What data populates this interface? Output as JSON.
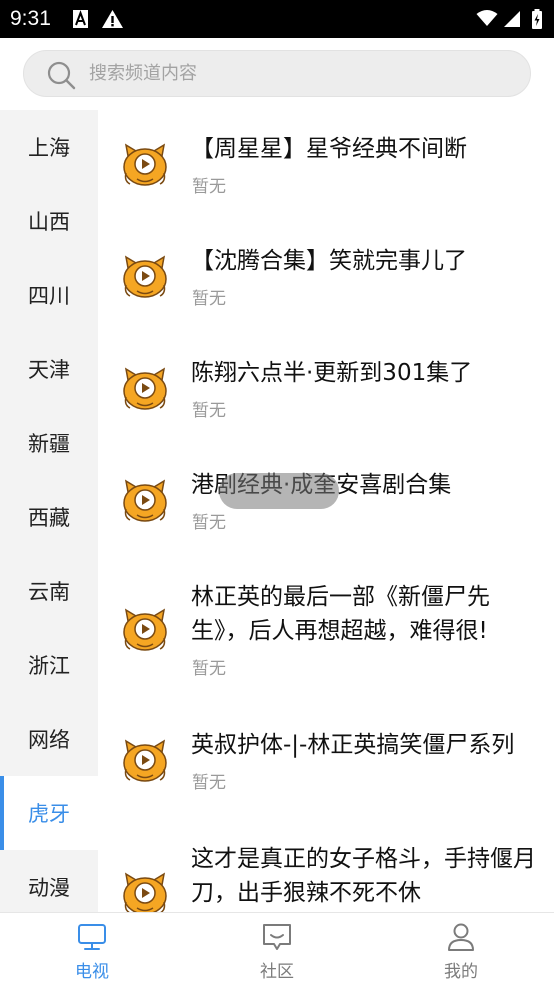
{
  "status_bar": {
    "time": "9:31"
  },
  "search": {
    "placeholder": "搜索频道内容"
  },
  "sidebar": {
    "active_index": 9,
    "items": [
      {
        "label": "上海"
      },
      {
        "label": "山西"
      },
      {
        "label": "四川"
      },
      {
        "label": "天津"
      },
      {
        "label": "新疆"
      },
      {
        "label": "西藏"
      },
      {
        "label": "云南"
      },
      {
        "label": "浙江"
      },
      {
        "label": "网络"
      },
      {
        "label": "虎牙"
      },
      {
        "label": "动漫"
      }
    ]
  },
  "list": {
    "items": [
      {
        "title": "【周星星】星爷经典不间断",
        "subtitle": "暂无"
      },
      {
        "title": "【沈腾合集】笑就完事儿了",
        "subtitle": "暂无"
      },
      {
        "title": "陈翔六点半·更新到301集了",
        "subtitle": "暂无"
      },
      {
        "title": "港剧经典·成奎安喜剧合集",
        "subtitle": "暂无"
      },
      {
        "title": "林正英的最后一部《新僵尸先生》，后人再想超越，难得很!",
        "subtitle": "暂无"
      },
      {
        "title": "英叔护体-|-林正英搞笑僵尸系列",
        "subtitle": "暂无"
      },
      {
        "title": "这才是真正的女子格斗，手持偃月刀，出手狠辣不死不休",
        "subtitle": ""
      }
    ]
  },
  "tabbar": {
    "tabs": [
      {
        "label": "电视",
        "icon": "tv-icon",
        "active": true
      },
      {
        "label": "社区",
        "icon": "chat-icon",
        "active": false
      },
      {
        "label": "我的",
        "icon": "user-icon",
        "active": false
      }
    ]
  },
  "colors": {
    "accent": "#3a8ee8",
    "logo_orange": "#f5a623",
    "logo_dark": "#7a4a12"
  }
}
